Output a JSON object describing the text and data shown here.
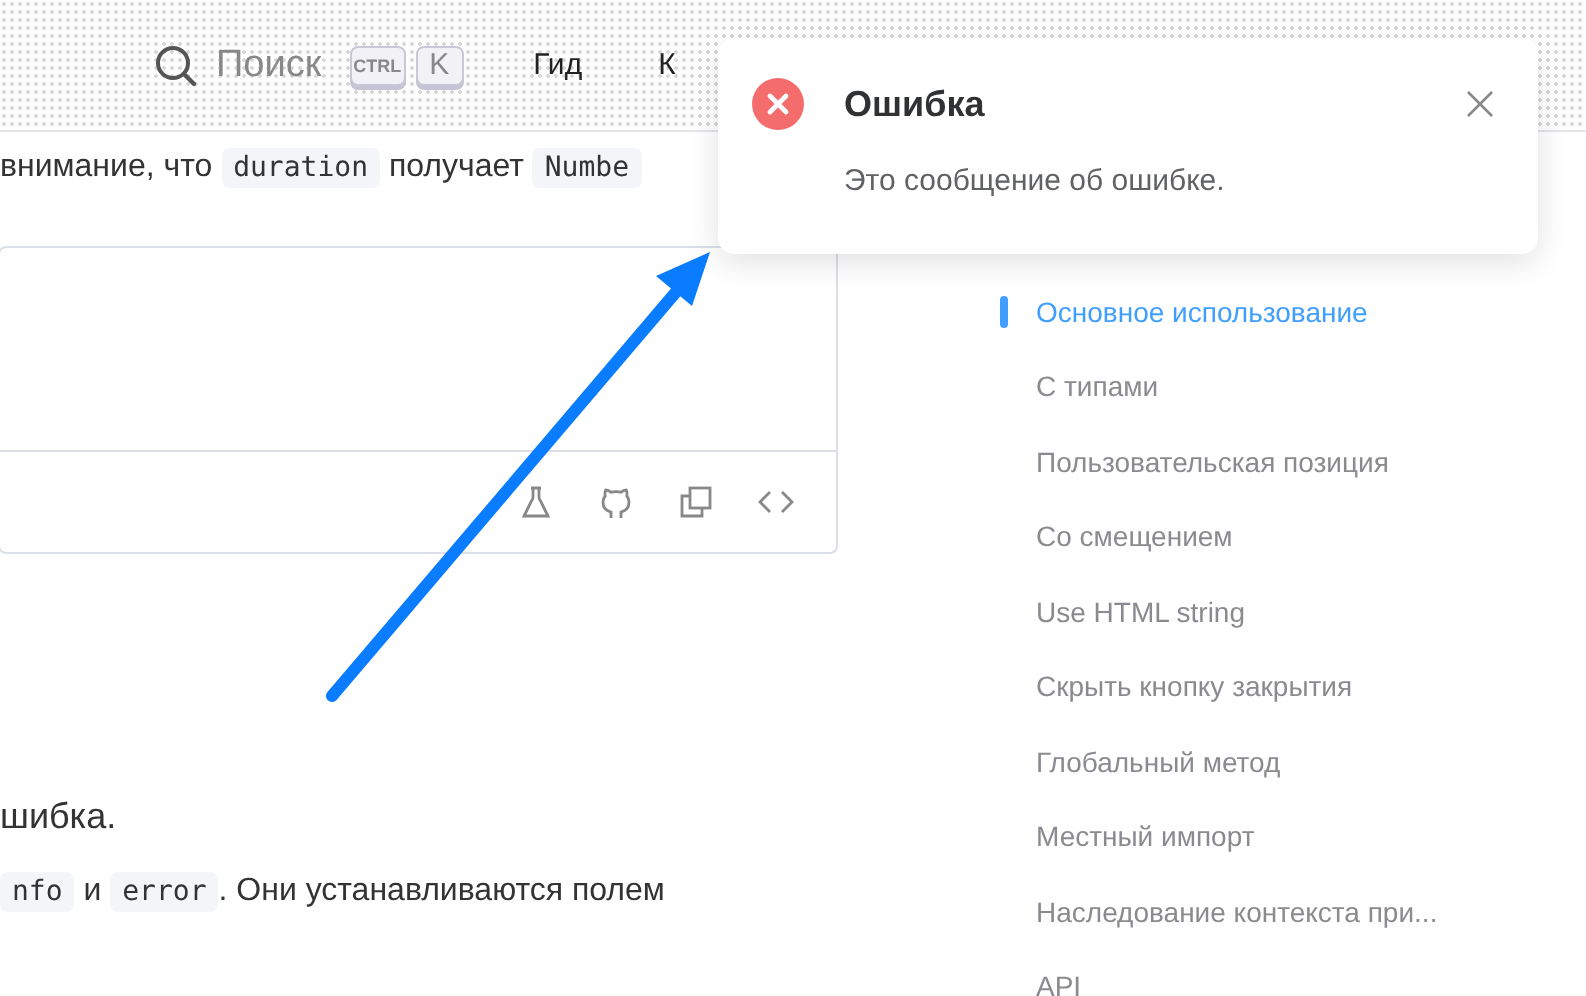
{
  "header": {
    "search": {
      "label": "Поиск",
      "keys": [
        "CTRL",
        "K"
      ]
    },
    "nav": [
      "Гид",
      "К"
    ]
  },
  "content": {
    "intro": [
      {
        "kind": "text",
        "text": "внимание, что "
      },
      {
        "kind": "code",
        "text": "duration"
      },
      {
        "kind": "text",
        "text": " получает "
      },
      {
        "kind": "code",
        "text": "Numbe"
      }
    ],
    "line_1": "шибка.",
    "line_2": [
      {
        "kind": "code",
        "text": "nfo"
      },
      {
        "kind": "text",
        "text": " и "
      },
      {
        "kind": "code",
        "text": "error"
      },
      {
        "kind": "text",
        "text": ". Они устанавливаются полем"
      }
    ]
  },
  "toc": {
    "items": [
      {
        "label": "Основное использование",
        "selected": true
      },
      {
        "label": "С типами",
        "selected": false
      },
      {
        "label": "Пользовательская позиция",
        "selected": false
      },
      {
        "label": "Со смещением",
        "selected": false
      },
      {
        "label": "Use HTML string",
        "selected": false
      },
      {
        "label": "Скрыть кнопку закрытия",
        "selected": false
      },
      {
        "label": "Глобальный метод",
        "selected": false
      },
      {
        "label": "Местный импорт",
        "selected": false
      },
      {
        "label": "Наследование контекста при...",
        "selected": false
      },
      {
        "label": "API",
        "selected": false
      }
    ]
  },
  "notification": {
    "title": "Ошибка",
    "message": "Это сообщение об ошибке."
  }
}
